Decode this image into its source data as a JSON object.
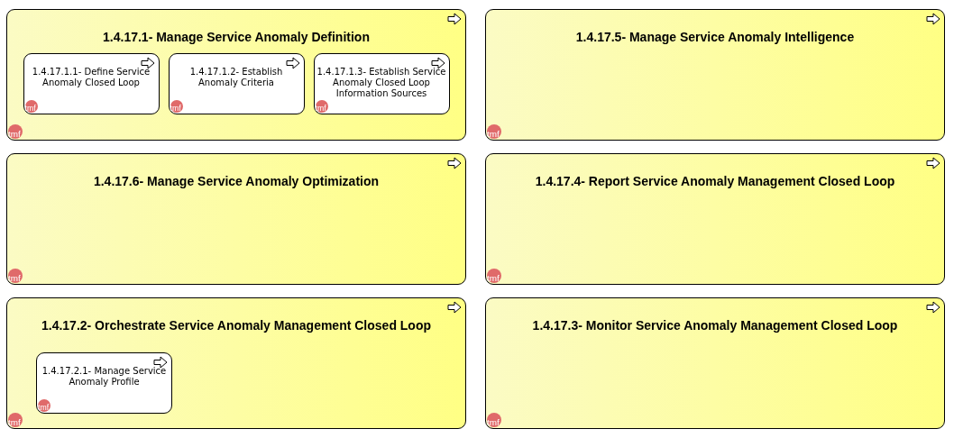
{
  "processes": [
    {
      "title": "1.4.17.1- Manage Service Anomaly Definition",
      "logo": "tmf",
      "children": [
        {
          "title": "1.4.17.1.1- Define Service Anomaly Closed Loop",
          "logo": "tmf"
        },
        {
          "title": "1.4.17.1.2- Establish Anomaly Criteria",
          "logo": "tmf"
        },
        {
          "title": "1.4.17.1.3- Establish Service Anomaly Closed Loop Information Sources",
          "logo": "tmf"
        }
      ]
    },
    {
      "title": "1.4.17.5- Manage Service Anomaly Intelligence",
      "logo": "tmf"
    },
    {
      "title": "1.4.17.6- Manage Service Anomaly Optimization",
      "logo": "tmf"
    },
    {
      "title": "1.4.17.4- Report Service Anomaly Management Closed Loop",
      "logo": "tmf"
    },
    {
      "title": "1.4.17.2- Orchestrate Service Anomaly Management Closed Loop",
      "logo": "tmf",
      "children": [
        {
          "title": "1.4.17.2.1- Manage Service Anomaly Profile",
          "logo": "tmf"
        }
      ]
    },
    {
      "title": "1.4.17.3- Monitor Service Anomaly Management Closed Loop",
      "logo": "tmf"
    }
  ]
}
